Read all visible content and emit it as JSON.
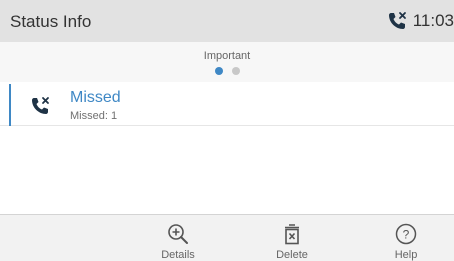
{
  "header": {
    "title": "Status Info",
    "time": "11:03",
    "status_icon": "missed-call-icon"
  },
  "pager": {
    "label": "Important",
    "pages": 2,
    "active_index": 0
  },
  "items": [
    {
      "title": "Missed",
      "subtitle": "Missed: 1",
      "icon": "missed-call-icon"
    }
  ],
  "toolbar": {
    "details": {
      "label": "Details",
      "icon": "zoom-in-icon"
    },
    "delete": {
      "label": "Delete",
      "icon": "delete-icon"
    },
    "help": {
      "label": "Help",
      "icon": "help-icon"
    }
  },
  "colors": {
    "accent": "#3f88c5",
    "header_bg": "#e2e2e2",
    "dot_inactive": "#c8c8c8",
    "icon_dark": "#1f3346",
    "toolbar_icon": "#555555"
  }
}
